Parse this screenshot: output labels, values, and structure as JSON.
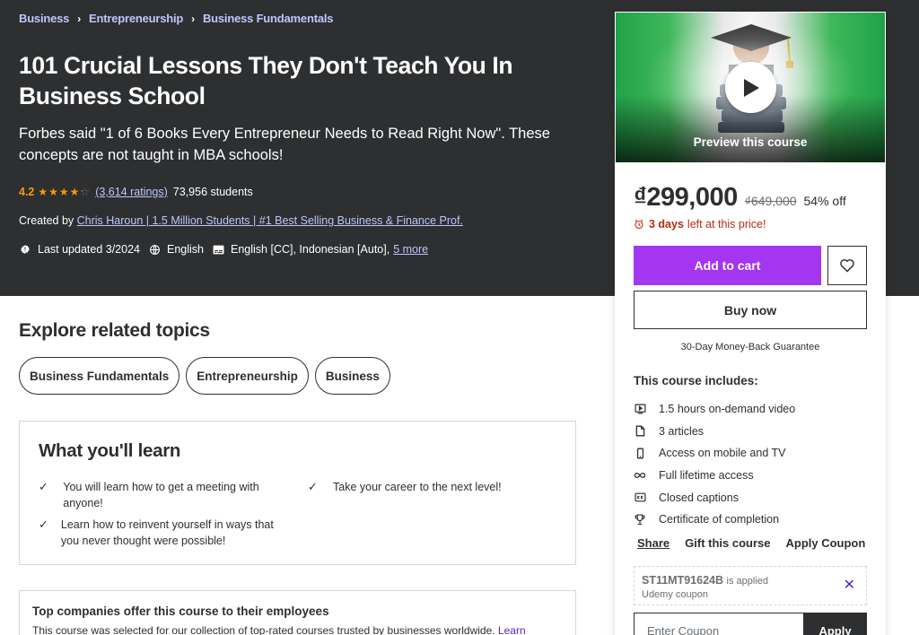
{
  "breadcrumb": [
    "Business",
    "Entrepreneurship",
    "Business Fundamentals"
  ],
  "course": {
    "title": "101 Crucial Lessons They Don't Teach You In Business School",
    "subtitle": "Forbes said \"1 of 6 Books Every Entrepreneur Needs to Read Right Now\". These concepts are not taught in MBA schools!",
    "rating": "4.2",
    "rating_value": 4.2,
    "rating_count": "(3,614 ratings)",
    "students": "73,956 students",
    "created_by_label": "Created by",
    "instructor": "Chris Haroun | 1.5 Million Students | #1 Best Selling Business & Finance Prof.",
    "last_updated": "Last updated 3/2024",
    "language": "English",
    "captions": "English [CC], Indonesian [Auto],",
    "more_link": "5 more"
  },
  "explore": {
    "title": "Explore related topics",
    "topics": [
      "Business Fundamentals",
      "Entrepreneurship",
      "Business"
    ]
  },
  "learn": {
    "title": "What you'll learn",
    "items": [
      "You will learn how to get a meeting with anyone!",
      "Take your career to the next level!",
      "Learn how to reinvent yourself in ways that you never thought were possible!"
    ]
  },
  "companies": {
    "title": "Top companies offer this course to their employees",
    "text": "This course was selected for our collection of top-rated courses trusted by businesses worldwide.",
    "link": "Learn"
  },
  "sidebar": {
    "preview_label": "Preview this course",
    "price": "₫299,000",
    "original_price": "₫649,000",
    "discount": "54% off",
    "timer_bold": "3 days",
    "timer_rest": "left at this price!",
    "add_to_cart": "Add to cart",
    "buy_now": "Buy now",
    "guarantee": "30-Day Money-Back Guarantee",
    "includes_title": "This course includes:",
    "includes": [
      {
        "icon": "video-icon",
        "label": "1.5 hours on-demand video"
      },
      {
        "icon": "file-icon",
        "label": "3 articles"
      },
      {
        "icon": "mobile-icon",
        "label": "Access on mobile and TV"
      },
      {
        "icon": "infinity-icon",
        "label": "Full lifetime access"
      },
      {
        "icon": "closed-captions-icon",
        "label": "Closed captions"
      },
      {
        "icon": "trophy-icon",
        "label": "Certificate of completion"
      }
    ],
    "share": "Share",
    "gift": "Gift this course",
    "apply_coupon": "Apply Coupon",
    "coupon_code": "ST11MT91624B",
    "coupon_applied": "is applied",
    "coupon_type": "Udemy coupon",
    "coupon_placeholder": "Enter Coupon",
    "apply": "Apply"
  },
  "colors": {
    "hero_bg": "#2d2f31",
    "link_light": "#c0c4fc",
    "star": "#f69c08",
    "primary": "#a435f0",
    "timer": "#b32d0f",
    "purple_link": "#5624d0"
  }
}
